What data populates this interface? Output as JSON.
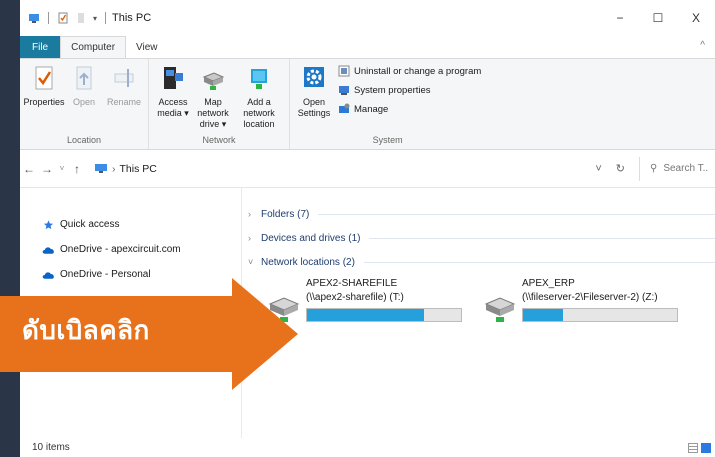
{
  "window": {
    "title": "This PC",
    "controls": {
      "minimize": "−",
      "maximize": "☐",
      "close": "X"
    }
  },
  "tabs": {
    "file": "File",
    "computer": "Computer",
    "view": "View",
    "collapse": "^"
  },
  "ribbon": {
    "location_group": {
      "label": "Location",
      "properties": "Properties",
      "open": "Open",
      "rename": "Rename"
    },
    "network_group": {
      "label": "Network",
      "access_media": "Access media ▾",
      "map_network_drive": "Map network drive ▾",
      "add_network_location": "Add a network location"
    },
    "system_group": {
      "label": "System",
      "open_settings": "Open Settings",
      "uninstall": "Uninstall or change a program",
      "system_properties": "System properties",
      "manage": "Manage"
    }
  },
  "addressbar": {
    "back": "←",
    "forward": "→",
    "recent": "˅",
    "up": "↑",
    "path": "This PC",
    "dropdown": "˅",
    "refresh": "↻",
    "search_placeholder": "Search T..."
  },
  "nav": {
    "items": [
      {
        "label": "Quick access"
      },
      {
        "label": "OneDrive - apexcircuit.com"
      },
      {
        "label": "OneDrive - Personal"
      }
    ]
  },
  "sections": {
    "folders": "Folders (7)",
    "devices": "Devices and drives (1)",
    "network": "Network locations (2)"
  },
  "drives": [
    {
      "name": "APEX2-SHAREFILE",
      "path": "(\\\\apex2-sharefile) (T:)",
      "used_fraction": 0.76
    },
    {
      "name": "APEX_ERP",
      "path": "(\\\\fileserver-2\\Fileserver-2) (Z:)",
      "used_fraction": 0.26
    }
  ],
  "status": {
    "items": "10 items"
  },
  "overlay": {
    "text": "ดับเบิลคลิก",
    "color": "#e8711c"
  }
}
